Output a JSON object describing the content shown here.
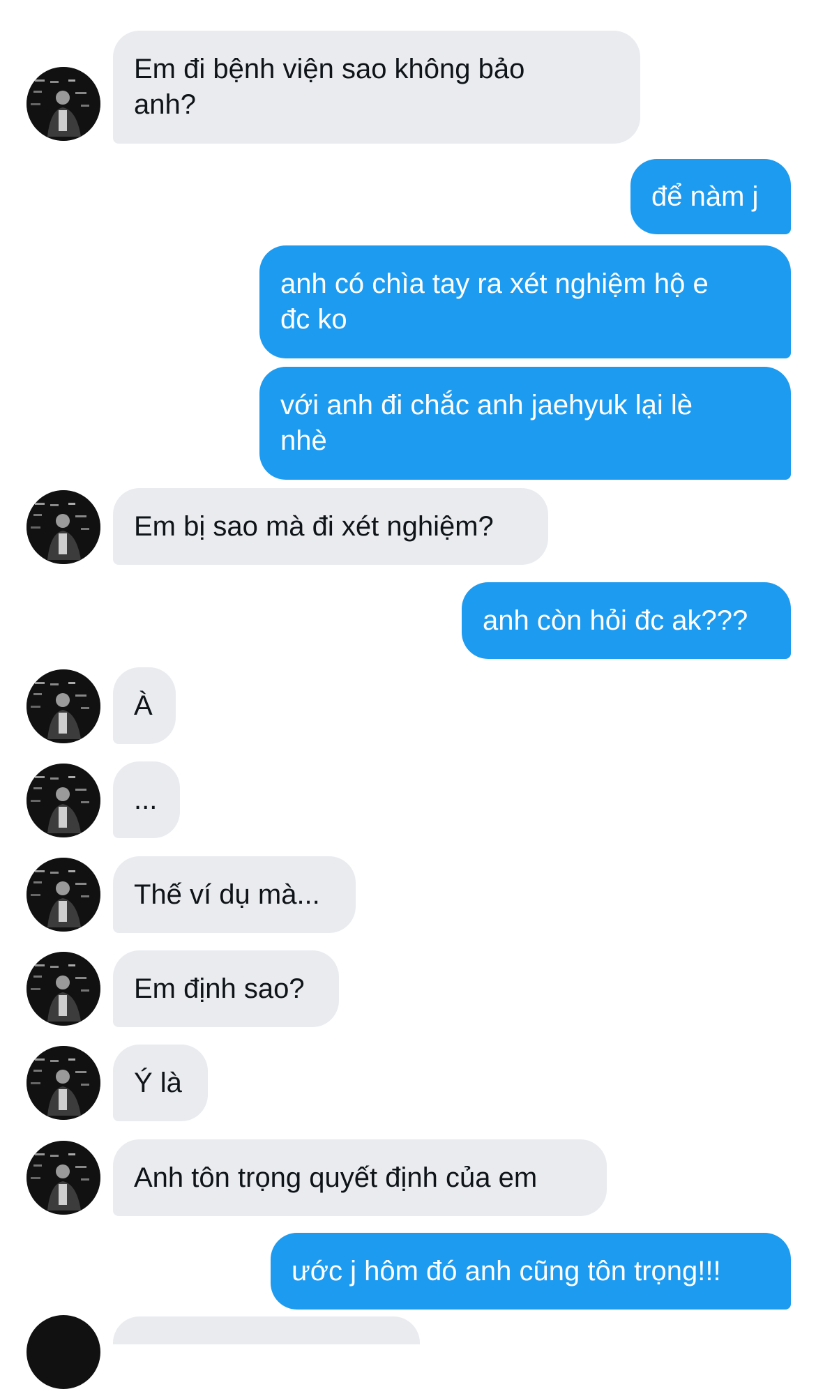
{
  "conversation": {
    "messages": [
      {
        "side": "in",
        "text": "Em đi bệnh viện sao không bảo\nanh?"
      },
      {
        "side": "out",
        "text": "để nàm j"
      },
      {
        "side": "out",
        "text": "anh có chìa tay ra xét nghiệm hộ e\nđc ko"
      },
      {
        "side": "out",
        "text": "với anh đi chắc anh jaehyuk lại lè\nnhè"
      },
      {
        "side": "in",
        "text": "Em bị sao mà đi xét nghiệm?"
      },
      {
        "side": "out",
        "text": "anh còn hỏi đc ak???"
      },
      {
        "side": "in",
        "text": "À"
      },
      {
        "side": "in",
        "text": "..."
      },
      {
        "side": "in",
        "text": "Thế ví dụ mà..."
      },
      {
        "side": "in",
        "text": "Em định sao?"
      },
      {
        "side": "in",
        "text": "Ý là"
      },
      {
        "side": "in",
        "text": "Anh tôn trọng quyết định của em"
      },
      {
        "side": "out",
        "text": "ước j hôm đó anh cũng tôn trọng!!!"
      }
    ]
  },
  "colors": {
    "incoming_bubble": "#e9ebef",
    "incoming_text": "#0f1419",
    "outgoing_bubble": "#1d9bf0",
    "outgoing_text": "#ffffff",
    "background": "#ffffff"
  },
  "icons": {
    "avatar": "contact-avatar-photo"
  }
}
